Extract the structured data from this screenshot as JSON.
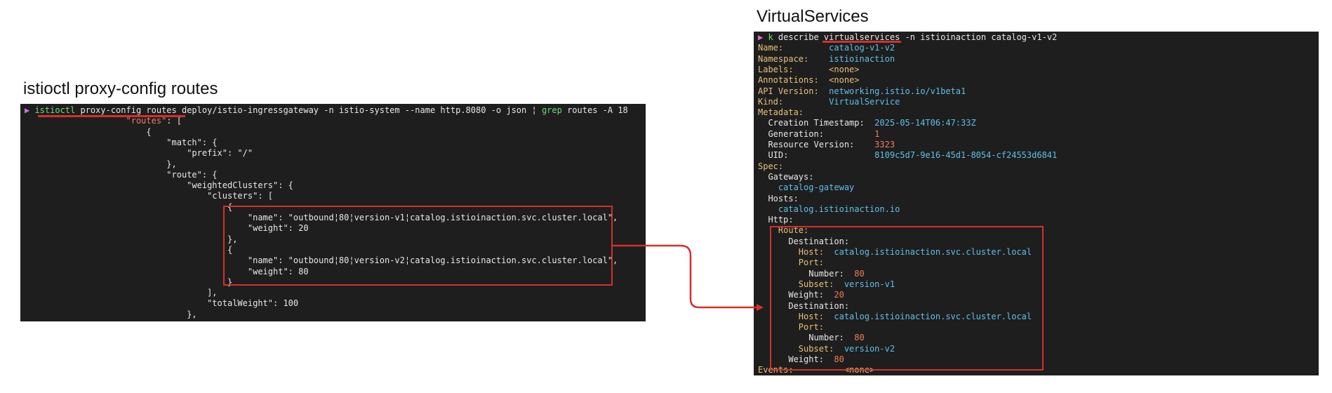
{
  "left_panel": {
    "heading": "istioctl proxy-config routes",
    "lines": [
      [
        [
          "▶ ",
          "prompt"
        ],
        [
          "istioctl",
          "cmd"
        ],
        [
          " proxy-config routes deploy/istio-ingressgateway -n istio-system --name http.8080 -o json ",
          "txt"
        ],
        [
          "¦",
          "txt"
        ],
        [
          " ",
          "txt"
        ],
        [
          "grep",
          "cmd"
        ],
        [
          " routes -A 18",
          "txt"
        ]
      ],
      [
        [
          "                    ",
          "txt"
        ],
        [
          "\"routes\"",
          "jkey"
        ],
        [
          ": [",
          "txt"
        ]
      ],
      [
        [
          "                        {",
          "txt"
        ]
      ],
      [
        [
          "                            \"match\": {",
          "txt"
        ]
      ],
      [
        [
          "                                \"prefix\": \"/\"",
          "txt"
        ]
      ],
      [
        [
          "                            },",
          "txt"
        ]
      ],
      [
        [
          "                            \"route\": {",
          "txt"
        ]
      ],
      [
        [
          "                                \"weightedClusters\": {",
          "txt"
        ]
      ],
      [
        [
          "                                    \"clusters\": [",
          "txt"
        ]
      ],
      [
        [
          "                                        {",
          "txt"
        ]
      ],
      [
        [
          "                                            \"name\": \"outbound¦80¦version-v1¦catalog.istioinaction.svc.cluster.local\",",
          "txt"
        ]
      ],
      [
        [
          "                                            \"weight\": 20",
          "txt"
        ]
      ],
      [
        [
          "                                        },",
          "txt"
        ]
      ],
      [
        [
          "                                        {",
          "txt"
        ]
      ],
      [
        [
          "                                            \"name\": \"outbound¦80¦version-v2¦catalog.istioinaction.svc.cluster.local\",",
          "txt"
        ]
      ],
      [
        [
          "                                            \"weight\": 80",
          "txt"
        ]
      ],
      [
        [
          "                                        }",
          "txt"
        ]
      ],
      [
        [
          "                                    ],",
          "txt"
        ]
      ],
      [
        [
          "                                    \"totalWeight\": 100",
          "txt"
        ]
      ],
      [
        [
          "                                },",
          "txt"
        ]
      ]
    ]
  },
  "right_panel": {
    "heading": "VirtualServices",
    "lines": [
      [
        [
          "▶ ",
          "prompt"
        ],
        [
          "k",
          "cmd"
        ],
        [
          " describe virtualservices -n istioinaction catalog-v1-v2",
          "txt"
        ]
      ],
      [
        [
          "Name:         ",
          "key"
        ],
        [
          "catalog-v1-v2",
          "val"
        ]
      ],
      [
        [
          "Namespace:    ",
          "key"
        ],
        [
          "istioinaction",
          "val"
        ]
      ],
      [
        [
          "Labels:       ",
          "key"
        ],
        [
          "<none>",
          "key"
        ]
      ],
      [
        [
          "Annotations:  ",
          "key"
        ],
        [
          "<none>",
          "key"
        ]
      ],
      [
        [
          "API Version:  ",
          "key"
        ],
        [
          "networking.istio.io/v1beta1",
          "val"
        ]
      ],
      [
        [
          "Kind:         ",
          "key"
        ],
        [
          "VirtualService",
          "val"
        ]
      ],
      [
        [
          "Metadata:",
          "key"
        ]
      ],
      [
        [
          "  Creation Timestamp:  ",
          "txt"
        ],
        [
          "2025-05-14T06:47:33Z",
          "val"
        ]
      ],
      [
        [
          "  Generation:          ",
          "txt"
        ],
        [
          "1",
          "num"
        ]
      ],
      [
        [
          "  Resource Version:    ",
          "txt"
        ],
        [
          "3323",
          "num"
        ]
      ],
      [
        [
          "  UID:                 ",
          "txt"
        ],
        [
          "8109c5d7-9e16-45d1-8054-cf24553d6841",
          "val"
        ]
      ],
      [
        [
          "Spec:",
          "key"
        ]
      ],
      [
        [
          "  Gateways:",
          "txt"
        ]
      ],
      [
        [
          "    ",
          "txt"
        ],
        [
          "catalog-gateway",
          "val"
        ]
      ],
      [
        [
          "  Hosts:",
          "txt"
        ]
      ],
      [
        [
          "    ",
          "txt"
        ],
        [
          "catalog.istioinaction.io",
          "val"
        ]
      ],
      [
        [
          "  Http:",
          "txt"
        ]
      ],
      [
        [
          "    Route:",
          "key"
        ]
      ],
      [
        [
          "      Destination:",
          "txt"
        ]
      ],
      [
        [
          "        Host:  ",
          "key"
        ],
        [
          "catalog.istioinaction.svc.cluster.local",
          "val"
        ]
      ],
      [
        [
          "        Port:",
          "key"
        ]
      ],
      [
        [
          "          Number:  ",
          "txt"
        ],
        [
          "80",
          "num"
        ]
      ],
      [
        [
          "        Subset:  ",
          "key"
        ],
        [
          "version-v1",
          "val"
        ]
      ],
      [
        [
          "      Weight:  ",
          "txt"
        ],
        [
          "20",
          "num"
        ]
      ],
      [
        [
          "      Destination:",
          "txt"
        ]
      ],
      [
        [
          "        Host:  ",
          "key"
        ],
        [
          "catalog.istioinaction.svc.cluster.local",
          "val"
        ]
      ],
      [
        [
          "        Port:",
          "key"
        ]
      ],
      [
        [
          "          Number:  ",
          "txt"
        ],
        [
          "80",
          "num"
        ]
      ],
      [
        [
          "        Subset:  ",
          "key"
        ],
        [
          "version-v2",
          "val"
        ]
      ],
      [
        [
          "      Weight:  ",
          "txt"
        ],
        [
          "80",
          "num"
        ]
      ],
      [
        [
          "Events:          ",
          "key"
        ],
        [
          "<none>",
          "key"
        ]
      ]
    ]
  },
  "colors": {
    "terminal_bg": "#1e1e1e",
    "highlight": "#d4302a",
    "prompt": "#d36fd8",
    "command": "#6fdc74",
    "key": "#e8c178",
    "value": "#5fc0e8",
    "number": "#f07b5a"
  }
}
